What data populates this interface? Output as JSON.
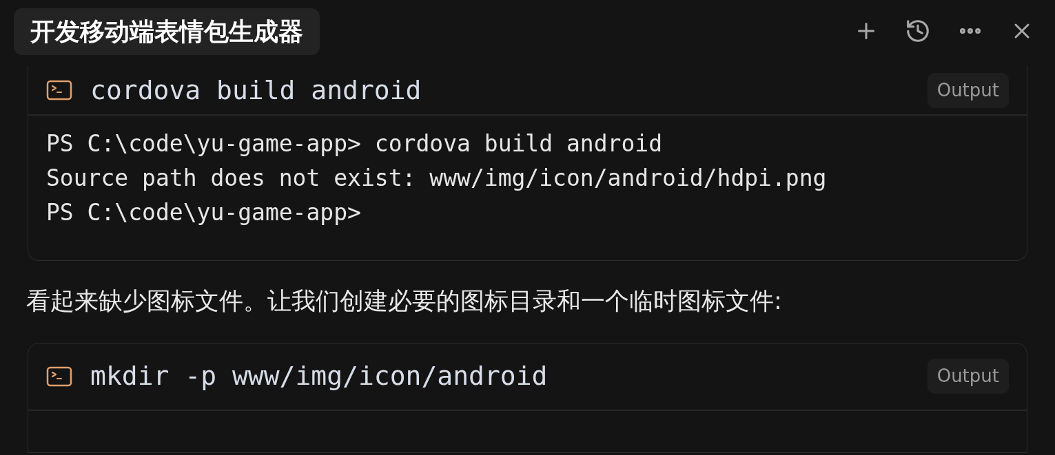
{
  "header": {
    "title": "开发移动端表情包生成器"
  },
  "blocks": [
    {
      "kind": "command",
      "command": "cordova build android",
      "output_button": "Output",
      "output_lines": [
        "PS C:\\code\\yu-game-app> cordova build android",
        "Source path does not exist: www/img/icon/android/hdpi.png",
        "PS C:\\code\\yu-game-app>"
      ]
    },
    {
      "kind": "text",
      "text": "看起来缺少图标文件。让我们创建必要的图标目录和一个临时图标文件:"
    },
    {
      "kind": "command",
      "command": "mkdir -p www/img/icon/android",
      "output_button": "Output"
    }
  ]
}
